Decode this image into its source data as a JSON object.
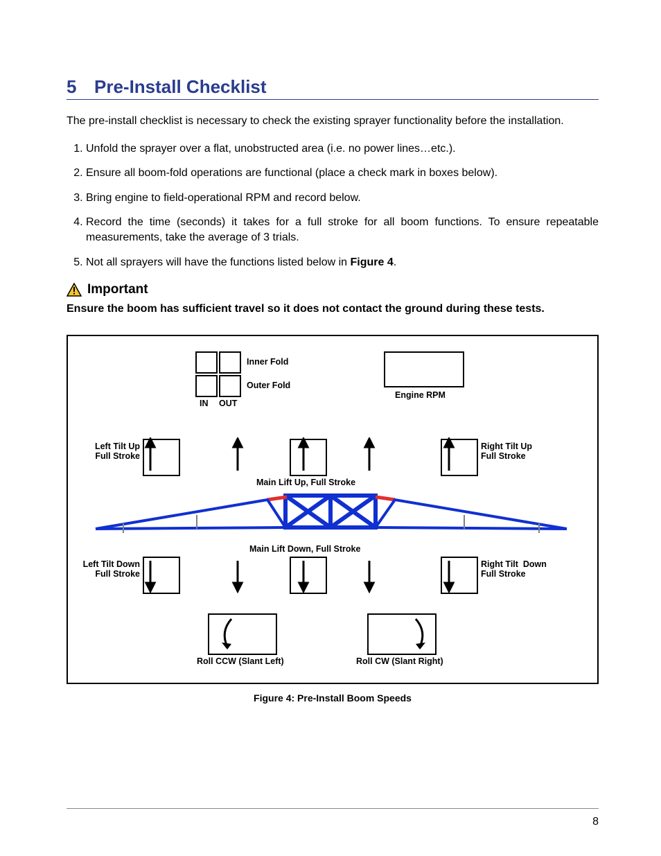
{
  "heading": {
    "number": "5",
    "title": "Pre-Install Checklist"
  },
  "intro": "The pre-install checklist is necessary to check the existing sprayer functionality before the installation.",
  "list": [
    "Unfold the sprayer over a flat, unobstructed area (i.e. no power lines…etc.).",
    "Ensure all boom-fold operations are functional (place a check mark in boxes below).",
    "Bring engine to field-operational RPM and record below.",
    "Record the time (seconds) it takes for a full stroke for all boom functions.  To ensure repeatable measurements, take the average of 3 trials.",
    "Not all sprayers will have the functions listed below in "
  ],
  "fig_ref": "Figure 4",
  "list5_tail": ".",
  "important_label": "Important",
  "important_text": "Ensure the boom has sufficient travel so it does not contact the ground during these tests.",
  "figure": {
    "inner_fold": "Inner Fold",
    "outer_fold": "Outer Fold",
    "in": "IN",
    "out": "OUT",
    "engine_rpm": "Engine RPM",
    "left_tilt_up": "Left Tilt Up\nFull Stroke",
    "right_tilt_up": "Right Tilt Up\nFull Stroke",
    "main_up": "Main Lift Up, Full Stroke",
    "main_down": "Main Lift Down, Full Stroke",
    "left_tilt_down": "Left Tilt Down\nFull Stroke",
    "right_tilt_down": "Right Tilt  Down\nFull Stroke",
    "roll_ccw": "Roll CCW (Slant Left)",
    "roll_cw": "Roll CW (Slant Right)",
    "caption": "Figure 4: Pre-Install Boom Speeds"
  },
  "page_number": "8"
}
